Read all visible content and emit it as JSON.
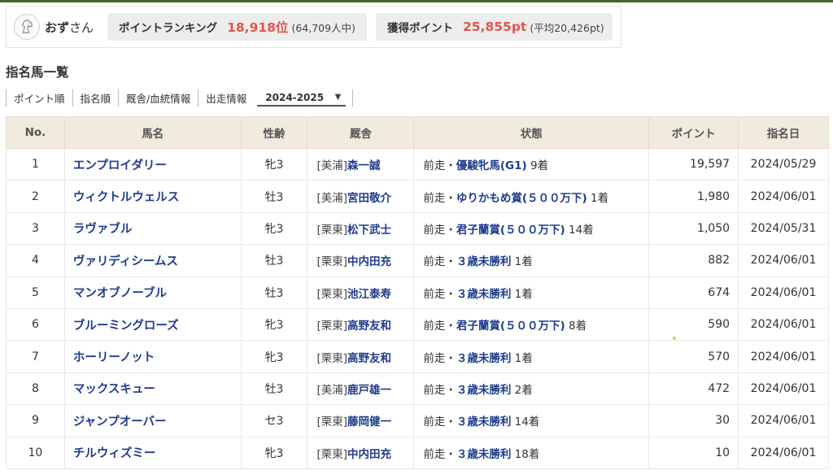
{
  "user": {
    "name": "おず",
    "honorific": "さん",
    "avatar_icon": "horse-head-icon"
  },
  "ranking": {
    "label": "ポイントランキング",
    "value": "18,918位",
    "sub": "(64,709人中)"
  },
  "points": {
    "label": "獲得ポイント",
    "value": "25,855pt",
    "sub": "(平均20,426pt)"
  },
  "section_title": "指名馬一覧",
  "filters": {
    "items": [
      "ポイント順",
      "指名順",
      "厩舎/血統情報",
      "出走情報"
    ],
    "season_selected": "2024-2025"
  },
  "table": {
    "headers": [
      "No.",
      "馬名",
      "性齢",
      "厩舎",
      "状態",
      "ポイント",
      "指名日"
    ],
    "rows": [
      {
        "no": "1",
        "name": "エンプロイダリー",
        "sex_age": "牝3",
        "area": "[美浦]",
        "trainer": "森一誠",
        "prefix": "前走・",
        "race": "優駿牝馬(G1)",
        "place": " 9着",
        "points": "19,597",
        "date": "2024/05/29"
      },
      {
        "no": "2",
        "name": "ウィクトルウェルス",
        "sex_age": "牡3",
        "area": "[美浦]",
        "trainer": "宮田敬介",
        "prefix": "前走・",
        "race": "ゆりかもめ賞(５００万下)",
        "place": " 1着",
        "points": "1,980",
        "date": "2024/06/01"
      },
      {
        "no": "3",
        "name": "ラヴァブル",
        "sex_age": "牝3",
        "area": "[栗東]",
        "trainer": "松下武士",
        "prefix": "前走・",
        "race": "君子蘭賞(５００万下)",
        "place": " 14着",
        "points": "1,050",
        "date": "2024/05/31"
      },
      {
        "no": "4",
        "name": "ヴァリディシームス",
        "sex_age": "牡3",
        "area": "[栗東]",
        "trainer": "中内田充",
        "prefix": "前走・",
        "race": "３歳未勝利",
        "place": " 1着",
        "points": "882",
        "date": "2024/06/01"
      },
      {
        "no": "5",
        "name": "マンオブノーブル",
        "sex_age": "牡3",
        "area": "[栗東]",
        "trainer": "池江泰寿",
        "prefix": "前走・",
        "race": "３歳未勝利",
        "place": " 1着",
        "points": "674",
        "date": "2024/06/01"
      },
      {
        "no": "6",
        "name": "ブルーミングローズ",
        "sex_age": "牝3",
        "area": "[栗東]",
        "trainer": "高野友和",
        "prefix": "前走・",
        "race": "君子蘭賞(５００万下)",
        "place": " 8着",
        "points": "590",
        "date": "2024/06/01"
      },
      {
        "no": "7",
        "name": "ホーリーノット",
        "sex_age": "牝3",
        "area": "[栗東]",
        "trainer": "高野友和",
        "prefix": "前走・",
        "race": "３歳未勝利",
        "place": " 1着",
        "points": "570",
        "date": "2024/06/01"
      },
      {
        "no": "8",
        "name": "マックスキュー",
        "sex_age": "牡3",
        "area": "[美浦]",
        "trainer": "鹿戸雄一",
        "prefix": "前走・",
        "race": "３歳未勝利",
        "place": " 2着",
        "points": "472",
        "date": "2024/06/01"
      },
      {
        "no": "9",
        "name": "ジャンプオーバー",
        "sex_age": "セ3",
        "area": "[栗東]",
        "trainer": "藤岡健一",
        "prefix": "前走・",
        "race": "３歳未勝利",
        "place": " 14着",
        "points": "30",
        "date": "2024/06/01"
      },
      {
        "no": "10",
        "name": "チルウィズミー",
        "sex_age": "牝3",
        "area": "[栗東]",
        "trainer": "中内田充",
        "prefix": "前走・",
        "race": "３歳未勝利",
        "place": " 18着",
        "points": "10",
        "date": "2024/06/01"
      }
    ]
  },
  "colors": {
    "accent_red": "#e0574a",
    "link_blue": "#1f3c8c",
    "header_bg": "#f1ebde",
    "top_green": "#3f6b2a"
  }
}
